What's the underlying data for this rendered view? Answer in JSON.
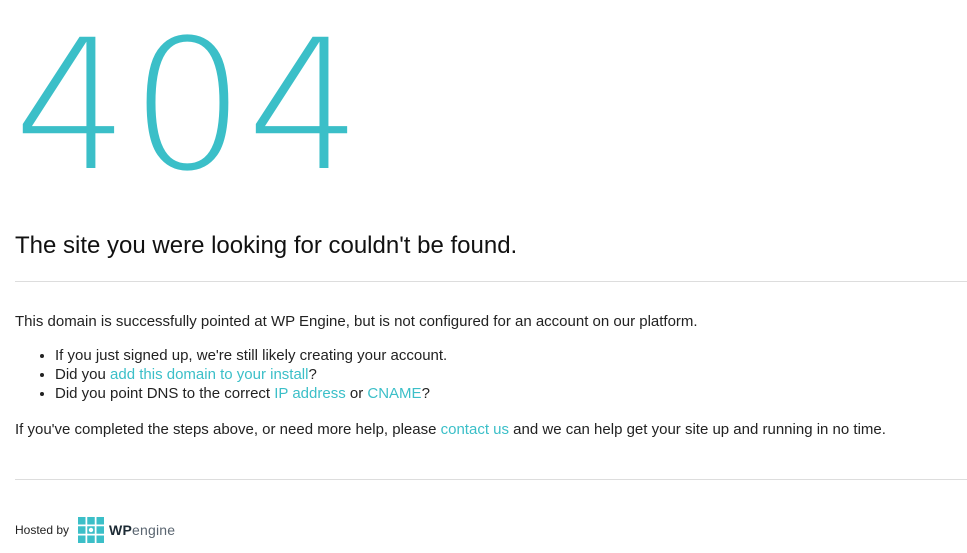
{
  "error": {
    "code": "404",
    "headline": "The site you were looking for couldn't be found."
  },
  "intro_text": "This domain is successfully pointed at WP Engine, but is not configured for an account on our platform.",
  "checklist": [
    {
      "text": "If you just signed up, we're still likely creating your account."
    },
    {
      "before": "Did you ",
      "link": "add this domain to your install",
      "after": "?"
    },
    {
      "before": "Did you point DNS to the correct ",
      "link1": "IP address",
      "middle": " or ",
      "link2": "CNAME",
      "after": "?"
    }
  ],
  "outro": {
    "before": "If you've completed the steps above, or need more help, please ",
    "link": "contact us",
    "after": " and we can help get your site up and running in no time."
  },
  "footer": {
    "hosted_by": "Hosted by",
    "logo_bold": "WP",
    "logo_light": "engine"
  },
  "colors": {
    "accent": "#3bbfc8",
    "text": "#222222",
    "rule": "#dddddd"
  }
}
